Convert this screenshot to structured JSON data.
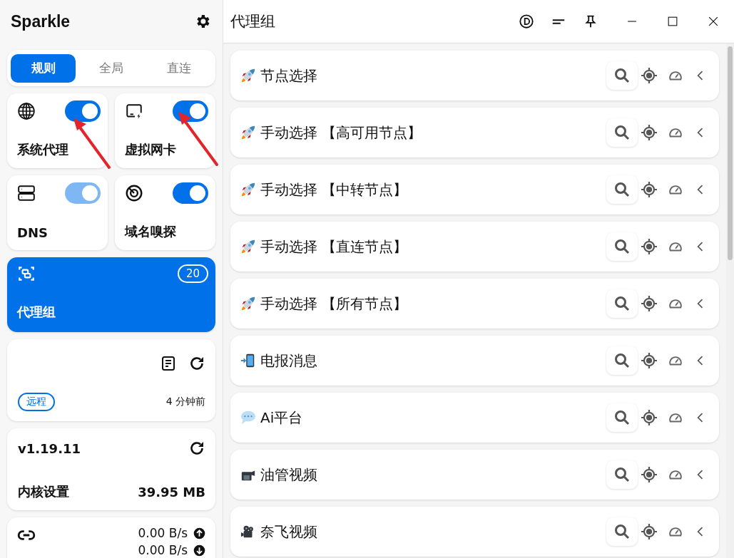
{
  "app": {
    "title": "Sparkle"
  },
  "mode_tabs": [
    {
      "label": "规则",
      "selected": true
    },
    {
      "label": "全局",
      "selected": false
    },
    {
      "label": "直连",
      "selected": false
    }
  ],
  "toggles": [
    {
      "label": "系统代理",
      "kind": "globe",
      "on": true,
      "disabled": false
    },
    {
      "label": "虚拟网卡",
      "kind": "monitor",
      "on": true,
      "disabled": false
    },
    {
      "label": "DNS",
      "kind": "server",
      "on": true,
      "disabled": true
    },
    {
      "label": "域名嗅探",
      "kind": "target",
      "on": true,
      "disabled": false
    }
  ],
  "proxy_group_card": {
    "label": "代理组",
    "count": "20",
    "selected": true
  },
  "profile_card": {
    "tag": "远程",
    "updated": "4 分钟前"
  },
  "core_card": {
    "version": "v1.19.11",
    "label": "内核设置",
    "memory": "39.95 MB"
  },
  "traffic_card": {
    "upload": "0.00 B/s",
    "download": "0.00 B/s"
  },
  "page": {
    "title": "代理组"
  },
  "groups": [
    {
      "name": "节点选择",
      "kind": "rocket"
    },
    {
      "name": "手动选择 【高可用节点】",
      "kind": "rocket"
    },
    {
      "name": "手动选择 【中转节点】",
      "kind": "rocket"
    },
    {
      "name": "手动选择 【直连节点】",
      "kind": "rocket"
    },
    {
      "name": "手动选择 【所有节点】",
      "kind": "rocket"
    },
    {
      "name": "电报消息",
      "kind": "phone"
    },
    {
      "name": "Ai平台",
      "kind": "chat"
    },
    {
      "name": "油管视频",
      "kind": "camera"
    },
    {
      "name": "奈飞视频",
      "kind": "movie"
    }
  ]
}
